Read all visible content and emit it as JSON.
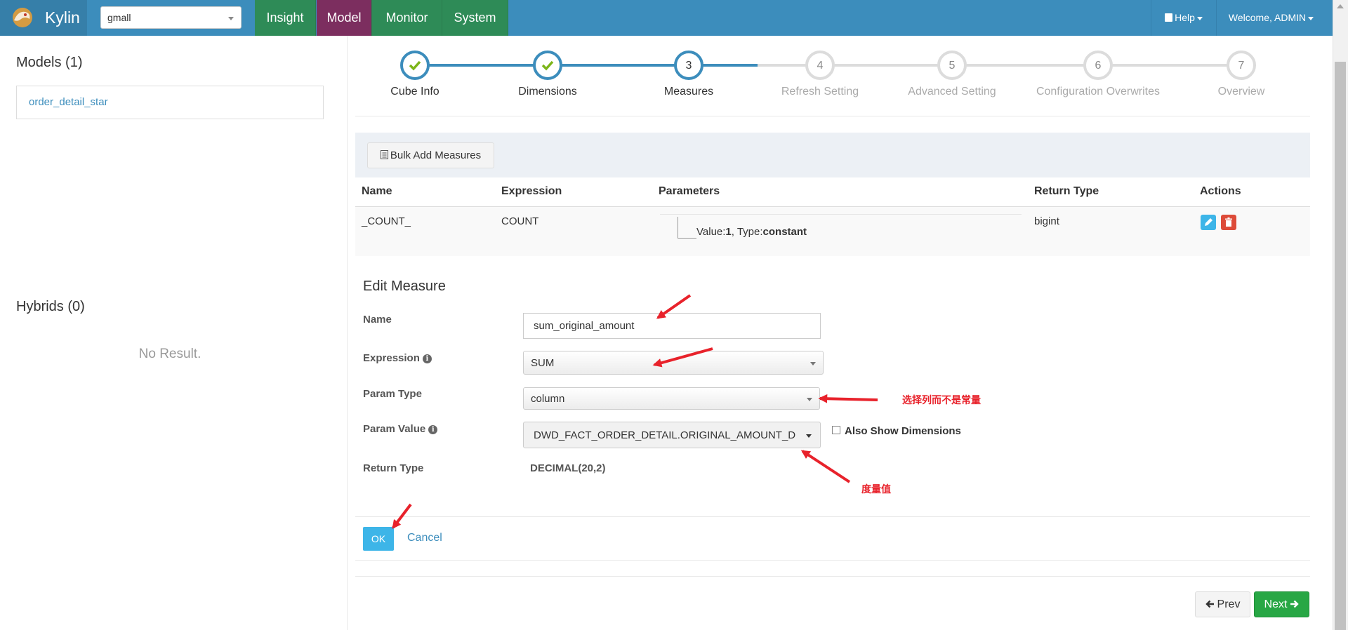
{
  "navbar": {
    "brand": "Kylin",
    "project": "gmall",
    "tabs": [
      "Insight",
      "Model",
      "Monitor",
      "System"
    ],
    "active_tab": "Model",
    "help": "Help",
    "welcome": "Welcome, ADMIN"
  },
  "left": {
    "models_title": "Models (1)",
    "models": [
      "order_detail_star"
    ],
    "hybrids_title": "Hybrids (0)",
    "no_result": "No Result."
  },
  "wizard": {
    "steps": [
      {
        "num": "1",
        "label": "Cube Info",
        "state": "done"
      },
      {
        "num": "2",
        "label": "Dimensions",
        "state": "done"
      },
      {
        "num": "3",
        "label": "Measures",
        "state": "active"
      },
      {
        "num": "4",
        "label": "Refresh Setting",
        "state": "todo"
      },
      {
        "num": "5",
        "label": "Advanced Setting",
        "state": "todo"
      },
      {
        "num": "6",
        "label": "Configuration Overwrites",
        "state": "todo"
      },
      {
        "num": "7",
        "label": "Overview",
        "state": "todo"
      }
    ]
  },
  "measures": {
    "bulk_add": "Bulk Add Measures",
    "headers": [
      "Name",
      "Expression",
      "Parameters",
      "Return Type",
      "Actions"
    ],
    "rows": [
      {
        "name": "_COUNT_",
        "expression": "COUNT",
        "param_value_label": "Value:",
        "param_value": "1",
        "param_type_label": ", Type:",
        "param_type": "constant",
        "return_type": "bigint"
      }
    ]
  },
  "edit": {
    "title": "Edit Measure",
    "name_label": "Name",
    "name_value": "sum_original_amount",
    "expression_label": "Expression",
    "expression_value": "SUM",
    "param_type_label": "Param Type",
    "param_type_value": "column",
    "param_value_label": "Param Value",
    "param_value": "DWD_FACT_ORDER_DETAIL.ORIGINAL_AMOUNT_D",
    "also_show": "Also Show Dimensions",
    "return_type_label": "Return Type",
    "return_type_value": "DECIMAL(20,2)",
    "ok": "OK",
    "cancel": "Cancel"
  },
  "annotations": {
    "choose_column": "选择列而不是常量",
    "measure_value": "度量值"
  },
  "pager": {
    "prev": "Prev",
    "next": "Next"
  },
  "colors": {
    "navbar": "#3c8dbc",
    "nav_tab": "#2e8b57",
    "active_tab": "#7c2e5f",
    "primary": "#3c8dbc",
    "ok": "#3db5e8",
    "next": "#28a745",
    "annotation": "#e8222b"
  }
}
